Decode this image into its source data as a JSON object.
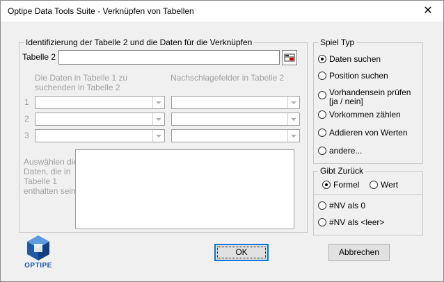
{
  "window": {
    "title": "Optipe Data Tools Suite - Verknüpfen von Tabellen",
    "close_glyph": "✕"
  },
  "ident": {
    "legend": "Identifizierung der Tabelle 2 und die Daten für die Verknüpfen",
    "tabelle2_label": "Tabelle 2",
    "tabelle2_value": "",
    "col1_header_line1": "Die Daten in Tabelle 1 zu",
    "col1_header_line2": "suchenden in Tabelle 2",
    "col2_header": "Nachschlagefelder in Tabelle 2",
    "rows": [
      "1",
      "2",
      "3"
    ],
    "select_label": [
      "Auswählen die",
      "Daten, die in",
      "Tabelle 1",
      "enthalten sein"
    ]
  },
  "spiel_typ": {
    "legend": "Spiel Typ",
    "options": [
      "Daten suchen",
      "Position suchen",
      "Vorhandensein prüfen",
      "[ja / nein]",
      "Vorkommen zählen",
      "Addieren von Werten",
      "andere..."
    ],
    "selected": "Daten suchen"
  },
  "gibt_zurueck": {
    "legend": "Gibt Zurück",
    "formel": "Formel",
    "wert": "Wert",
    "selected": "Formel",
    "nv0": "#NV als 0",
    "nvleer": "#NV als <leer>"
  },
  "buttons": {
    "ok": "OK",
    "cancel": "Abbrechen"
  },
  "logo": {
    "text": "OPTIPE"
  },
  "colors": {
    "accent": "#0078d7",
    "logo_blue": "#1e5aa8"
  }
}
